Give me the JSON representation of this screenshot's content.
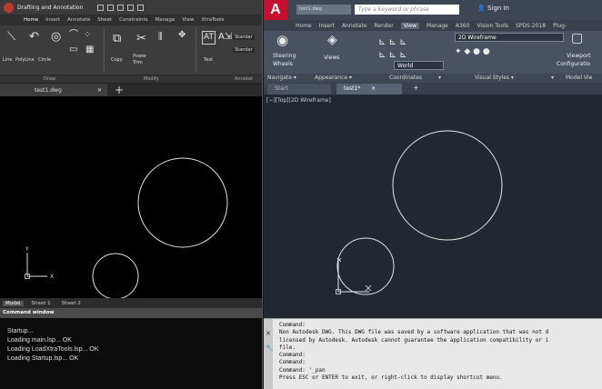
{
  "left": {
    "workspace": "Drafting and Annotation",
    "tabs": [
      "Home",
      "Insert",
      "Annotate",
      "Sheet",
      "Constraints",
      "Manage",
      "View",
      "XtraTools"
    ],
    "active_tab": "Home",
    "tools": {
      "line": "Line",
      "polyline": "PolyLine",
      "circle": "Circle",
      "copy": "Copy",
      "power": "Power",
      "trim": "Trim",
      "text": "Text"
    },
    "style_labels": [
      "Standar",
      "Standar"
    ],
    "panels": {
      "draw": "Draw",
      "modify": "Modify",
      "annotate": "Annotat"
    },
    "doc_tab": "test1.dwg",
    "close_glyph": "✕",
    "plus_glyph": "+",
    "ucs": {
      "x": "X",
      "y": "Y"
    },
    "layouts": [
      "Model",
      "Sheet 1",
      "Sheet 2"
    ],
    "command_header": "Command window",
    "command_lines": [
      "Startup...",
      "Loading main.lsp... OK",
      "Loading LoadXtraTools.lsp... OK",
      "Loading Startup.lsp... OK"
    ]
  },
  "right": {
    "logo": "A",
    "filename": "test1.dwg",
    "search_placeholder": "Type a keyword or phrase",
    "sign_in": "Sign In",
    "menu": [
      "Home",
      "Insert",
      "Annotate",
      "Render",
      "View",
      "Manage",
      "A360",
      "Vision Tools",
      "SPDS 2018",
      "Plug-"
    ],
    "active_menu": "View",
    "tools": {
      "steering": "Steering",
      "wheels": "Wheels",
      "views": "Views",
      "viewport": "Viewport",
      "configuration": "Configuratio"
    },
    "visual_style": "2D Wireframe",
    "ucs_select": "World",
    "panels": [
      "Navigate ▾",
      "Appearance ▾",
      "Coordinates",
      "▾",
      "Visual Styles ▾",
      "▾",
      "Model Vie"
    ],
    "doc_tabs": [
      "Start",
      "test1*"
    ],
    "tab_close": "✕",
    "tab_plus": "+",
    "viewport_label": "[−][Top][2D Wireframe]",
    "cmd_icons": [
      "✕",
      "🔧"
    ],
    "command_lines": [
      "Command:",
      "Non Autodesk DWG.  This DWG file was saved by a software application that was not d",
      "licensed by Autodesk.  Autodesk cannot guarantee the application compatibility or i",
      "file.",
      "Command:",
      "Command:",
      "Command: '_pan",
      "Press ESC or ENTER to exit, or right-click to display shortcut menu."
    ]
  }
}
